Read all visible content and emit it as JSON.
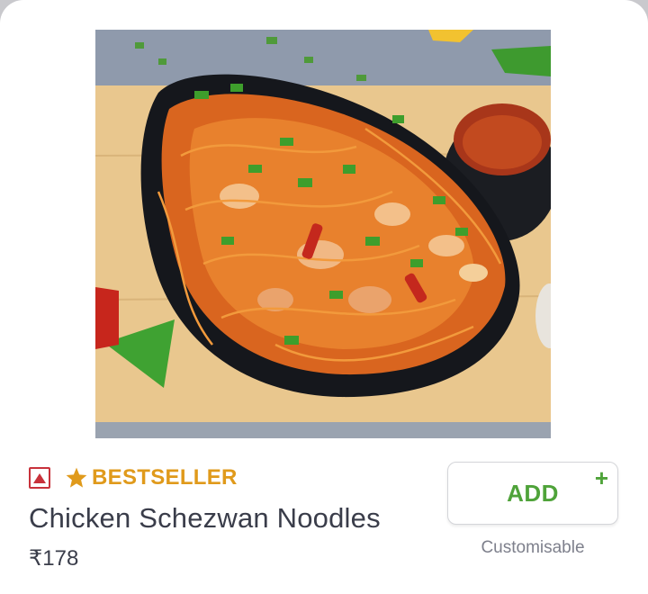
{
  "item": {
    "image_alt": "Chicken Schezwan Noodles",
    "diet_icon": "non-veg-triangle-icon",
    "badge_icon": "star-icon",
    "badge": "BESTSELLER",
    "name": "Chicken Schezwan Noodles",
    "price": "₹178"
  },
  "actions": {
    "add_label": "ADD",
    "plus_symbol": "+",
    "customisable_note": "Customisable"
  },
  "colors": {
    "nonveg_red": "#c8323b",
    "bestseller_amber": "#e09a1b",
    "add_green": "#4fa33a",
    "text_dark": "#3a3d4a",
    "text_muted": "#7e808c"
  }
}
